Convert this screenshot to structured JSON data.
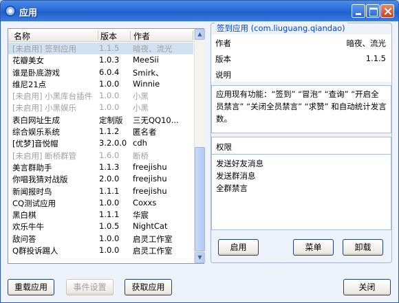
{
  "window": {
    "title": "应用"
  },
  "list": {
    "headers": {
      "name": "名称",
      "version": "版本",
      "author": "作者"
    },
    "rows": [
      {
        "name": "[未启用] 签到应用",
        "version": "1.1.5",
        "author": "暗夜、流光",
        "disabled": true,
        "selected": true
      },
      {
        "name": "花瓣美女",
        "version": "1.0.3",
        "author": "MeeSii",
        "disabled": false,
        "selected": false
      },
      {
        "name": "谁是卧底游戏",
        "version": "6.0.4",
        "author": "Smirk、",
        "disabled": false,
        "selected": false
      },
      {
        "name": "维尼21点",
        "version": "1.0.0",
        "author": "Winnie",
        "disabled": false,
        "selected": false
      },
      {
        "name": "[未启用] 小黑库台插件",
        "version": "1.0.0",
        "author": "小黑",
        "disabled": true,
        "selected": false
      },
      {
        "name": "[未启用] 小黑娱乐",
        "version": "1.0.0",
        "author": "小黑",
        "disabled": true,
        "selected": false
      },
      {
        "name": "表白网址生成",
        "version": "定制版",
        "author": "三无QQ10...",
        "disabled": false,
        "selected": false
      },
      {
        "name": "综合娱乐系统",
        "version": "1.1.2",
        "author": "匿名者",
        "disabled": false,
        "selected": false
      },
      {
        "name": "[优梦]音悦帽",
        "version": "3.2.0.0",
        "author": "cdh",
        "disabled": false,
        "selected": false
      },
      {
        "name": "[未启用] 断桥群管",
        "version": "1.6.0",
        "author": "断桥",
        "disabled": true,
        "selected": false
      },
      {
        "name": "美言群助手",
        "version": "1.1.3",
        "author": "freejishu",
        "disabled": false,
        "selected": false
      },
      {
        "name": "你唱我猜对战版",
        "version": "2.0.0",
        "author": "freejishu",
        "disabled": false,
        "selected": false
      },
      {
        "name": "新闻报时鸟",
        "version": "1.1.1",
        "author": "freejishu",
        "disabled": false,
        "selected": false
      },
      {
        "name": "CQ测试应用",
        "version": "1.0.0",
        "author": "Coxxs",
        "disabled": false,
        "selected": false
      },
      {
        "name": "黑白棋",
        "version": "1.1.1",
        "author": "华宸",
        "disabled": false,
        "selected": false
      },
      {
        "name": "欢乐牛牛",
        "version": "1.0.5",
        "author": "NightCat",
        "disabled": false,
        "selected": false
      },
      {
        "name": "敌问答",
        "version": "1.0.0",
        "author": "启灵工作室",
        "disabled": false,
        "selected": false
      },
      {
        "name": "Q群投诉踢人",
        "version": "1.0.0",
        "author": "启灵工作室",
        "disabled": false,
        "selected": false
      }
    ]
  },
  "detail": {
    "group_title": "签到应用 (com.liuguang.qiandao)",
    "author_label": "作者",
    "author_value": "暗夜、流光",
    "version_label": "版本",
    "version_value": "1.1.5",
    "description_label": "说明",
    "function_text": "应用现有功能：“签到” “冒泡” “查询” “开启全员禁言” “关闭全员禁言” “求赞” 和自动统计发言数。",
    "permissions_title": "权限",
    "permissions": [
      "发送好友消息",
      "发送群消息",
      "全群禁言"
    ],
    "enable_button": "启用",
    "menu_button": "菜单",
    "uninstall_button": "卸载"
  },
  "footer": {
    "reload_button": "重载应用",
    "event_settings_button": "事件设置",
    "get_apps_button": "获取应用",
    "close_button": "关闭"
  },
  "colors": {
    "title_bar": "#2a6ad9",
    "group_title": "#0046d5",
    "selected_row": "#d2e0f3",
    "disabled_text": "#a0a0a0"
  }
}
